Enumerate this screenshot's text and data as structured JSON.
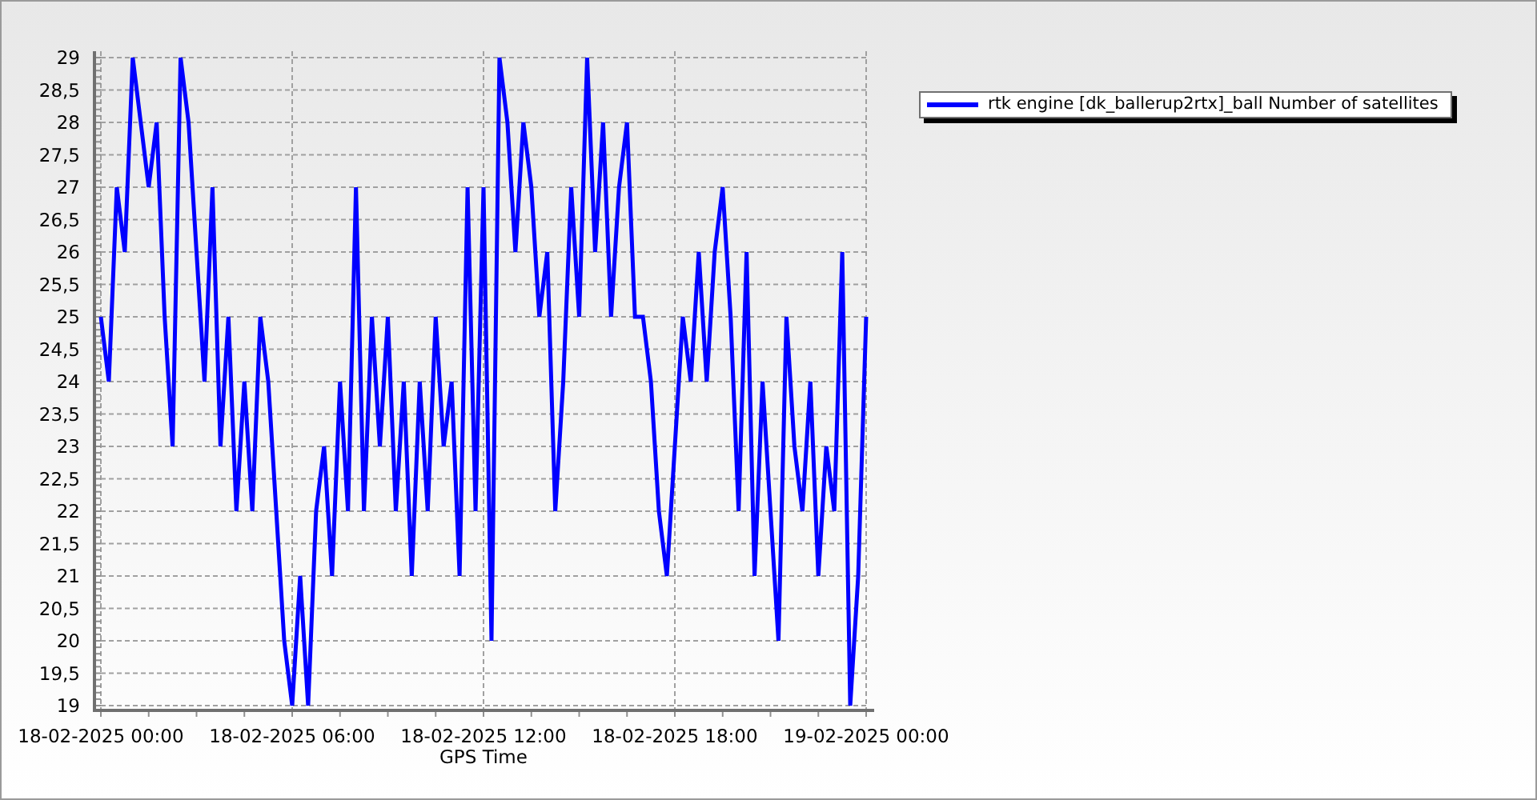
{
  "chart": {
    "chart_data": {
      "type": "line",
      "grid": true,
      "xlabel": "GPS Time",
      "ylim": [
        19,
        29
      ],
      "yticks": [
        {
          "value": 19,
          "label": "19"
        },
        {
          "value": 19.5,
          "label": "19,5"
        },
        {
          "value": 20,
          "label": "20"
        },
        {
          "value": 20.5,
          "label": "20,5"
        },
        {
          "value": 21,
          "label": "21"
        },
        {
          "value": 21.5,
          "label": "21,5"
        },
        {
          "value": 22,
          "label": "22"
        },
        {
          "value": 22.5,
          "label": "22,5"
        },
        {
          "value": 23,
          "label": "23"
        },
        {
          "value": 23.5,
          "label": "23,5"
        },
        {
          "value": 24,
          "label": "24"
        },
        {
          "value": 24.5,
          "label": "24,5"
        },
        {
          "value": 25,
          "label": "25"
        },
        {
          "value": 25.5,
          "label": "25,5"
        },
        {
          "value": 26,
          "label": "26"
        },
        {
          "value": 26.5,
          "label": "26,5"
        },
        {
          "value": 27,
          "label": "27"
        },
        {
          "value": 27.5,
          "label": "27,5"
        },
        {
          "value": 28,
          "label": "28"
        },
        {
          "value": 28.5,
          "label": "28,5"
        },
        {
          "value": 29,
          "label": "29"
        }
      ],
      "categories": [
        "18-02-2025 00:00",
        null,
        null,
        null,
        null,
        null,
        null,
        null,
        null,
        null,
        null,
        null,
        null,
        null,
        null,
        null,
        null,
        null,
        null,
        null,
        null,
        null,
        null,
        null,
        "18-02-2025 06:00",
        null,
        null,
        null,
        null,
        null,
        null,
        null,
        null,
        null,
        null,
        null,
        null,
        null,
        null,
        null,
        null,
        null,
        null,
        null,
        null,
        null,
        null,
        null,
        "18-02-2025 12:00",
        null,
        null,
        null,
        null,
        null,
        null,
        null,
        null,
        null,
        null,
        null,
        null,
        null,
        null,
        null,
        null,
        null,
        null,
        null,
        null,
        null,
        null,
        null,
        "18-02-2025 18:00",
        null,
        null,
        null,
        null,
        null,
        null,
        null,
        null,
        null,
        null,
        null,
        null,
        null,
        null,
        null,
        null,
        null,
        null,
        null,
        null,
        null,
        null,
        null,
        "19-02-2025 00:00"
      ],
      "series": [
        {
          "name": "rtk engine [dk_ballerup2rtx]_ball Number of satellites",
          "color": "#0000ff",
          "values": [
            25,
            24,
            27,
            26,
            29,
            28,
            27,
            28,
            25,
            23,
            29,
            28,
            26,
            24,
            27,
            23,
            25,
            22,
            24,
            22,
            25,
            24,
            22,
            20,
            19,
            21,
            19,
            22,
            23,
            21,
            24,
            22,
            27,
            22,
            25,
            23,
            25,
            22,
            24,
            21,
            24,
            22,
            25,
            23,
            24,
            21,
            27,
            22,
            27,
            20,
            29,
            28,
            26,
            28,
            27,
            25,
            26,
            22,
            24,
            27,
            25,
            29,
            26,
            28,
            25,
            27,
            28,
            25,
            25,
            24,
            22,
            21,
            23,
            25,
            24,
            26,
            24,
            26,
            27,
            25,
            22,
            26,
            21,
            24,
            22,
            20,
            25,
            23,
            22,
            24,
            21,
            23,
            22,
            26,
            19,
            21,
            25
          ]
        }
      ]
    }
  }
}
